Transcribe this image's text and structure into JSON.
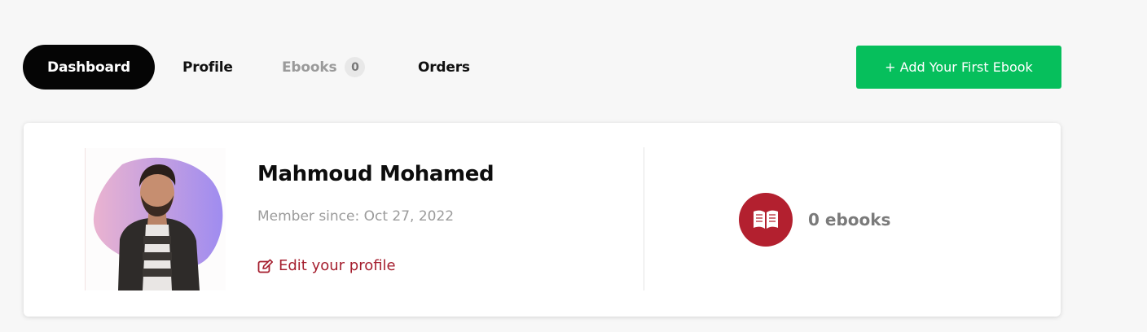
{
  "nav": {
    "tabs": [
      {
        "label": "Dashboard",
        "active": true
      },
      {
        "label": "Profile",
        "active": false
      },
      {
        "label": "Ebooks",
        "active": false,
        "count": "0"
      },
      {
        "label": "Orders",
        "active": false
      }
    ],
    "add_button_label": "+ Add Your First Ebook"
  },
  "profile": {
    "name": "Mahmoud Mohamed",
    "member_since": "Member since: Oct 27, 2022",
    "edit_label": "Edit your profile",
    "edit_icon": "edit-icon"
  },
  "stats": {
    "ebooks_label": "0 ebooks",
    "icon": "book-icon"
  },
  "colors": {
    "active_tab_bg": "#050505",
    "add_button_bg": "#06bf5c",
    "accent_red": "#b3202f",
    "link_red": "#a51e2e"
  }
}
